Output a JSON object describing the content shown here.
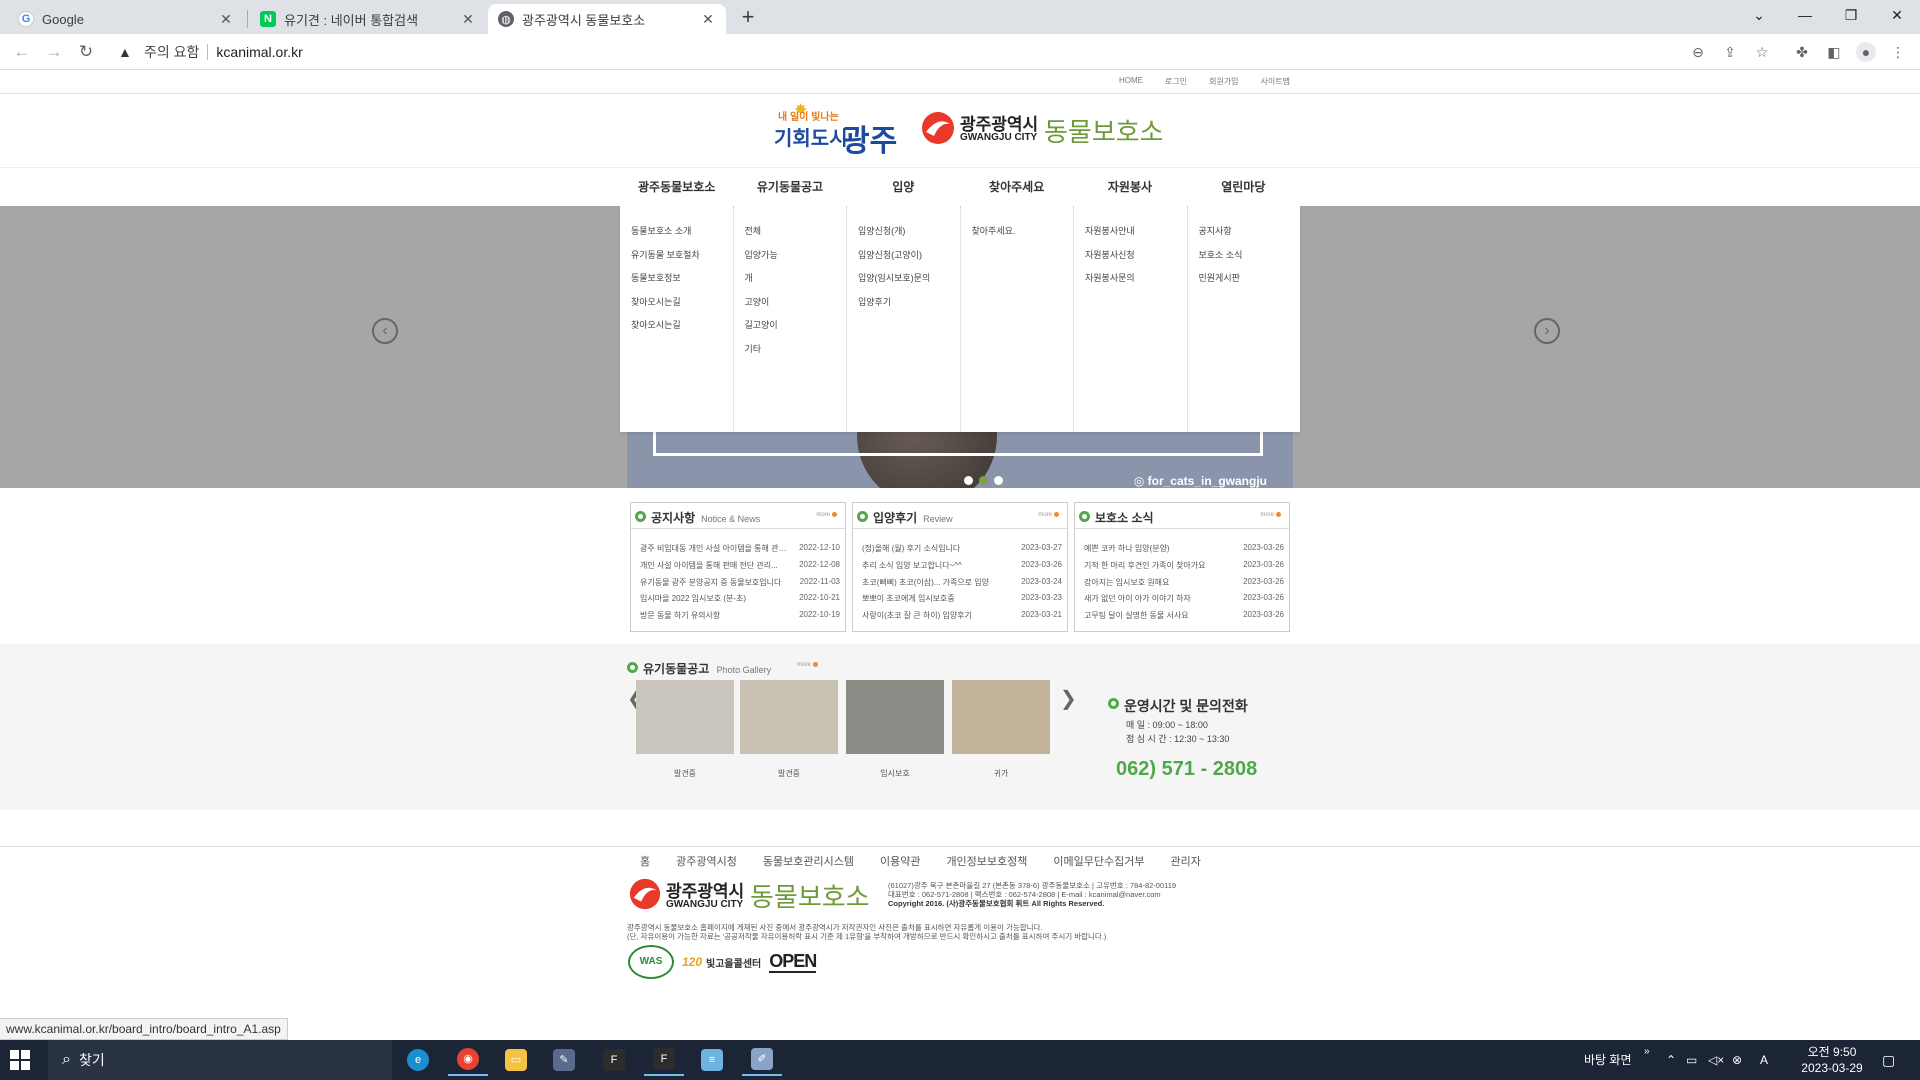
{
  "browser": {
    "tabs": [
      {
        "title": "Google",
        "favicon": "google-icon",
        "active": false
      },
      {
        "title": "유기견 : 네이버 통합검색",
        "favicon": "naver-icon",
        "active": false
      },
      {
        "title": "광주광역시 동물보호소",
        "favicon": "globe-icon",
        "active": true
      }
    ],
    "omnibox": {
      "security_label": "주의 요함",
      "url": "kcanimal.or.kr"
    },
    "status_url": "www.kcanimal.or.kr/board_intro/board_intro_A1.asp"
  },
  "site": {
    "utility_links": [
      "HOME",
      "로그인",
      "회원가입",
      "사이트맵"
    ],
    "logo_left": {
      "sub": "내 일이 빛나는",
      "main": "기회도시",
      "big": "광주"
    },
    "logo_center": {
      "korean": "광주광역시",
      "english": "GWANGJU CITY",
      "green": "동물보호소"
    },
    "gnb": [
      "광주동물보호소",
      "유기동물공고",
      "입양",
      "찾아주세요",
      "자원봉사",
      "열린마당"
    ],
    "mega_menu": [
      [
        "동물보호소 소개",
        "유기동물 보호절차",
        "동물보호정보",
        "찾아오시는길",
        "찾아오시는길"
      ],
      [
        "전체",
        "입양가능",
        "개",
        "고양이",
        "길고양이",
        "기타"
      ],
      [
        "입양신청(개)",
        "입양신청(고양이)",
        "입양(임시보호)문의",
        "입양후기"
      ],
      [
        "찾아주세요."
      ],
      [
        "자원봉사안내",
        "자원봉사신청",
        "자원봉사문의"
      ],
      [
        "공지사항",
        "보호소 소식",
        "민원게시판"
      ]
    ],
    "hero": {
      "instagram": "for_cats_in_gwangju",
      "active_dot": 1
    }
  },
  "boards": [
    {
      "title": "공지사항",
      "subtitle": "Notice & News",
      "more": "more",
      "rows": [
        {
          "title": "광주 비임대동 개인 사설 아이템을 통해 관리중...",
          "date": "2022-12-10"
        },
        {
          "title": "개인 사설 아이템을 통해 판매 전단 관리...",
          "date": "2022-12-08"
        },
        {
          "title": "유기동물 광주 분양공지 중 동물보호입니다",
          "date": "2022-11-03"
        },
        {
          "title": "입시마을 2022 임시보호 (분-초)",
          "date": "2022-10-21"
        },
        {
          "title": "방문 동물 하기 유의사항",
          "date": "2022-10-19"
        }
      ]
    },
    {
      "title": "입양후기",
      "subtitle": "Review",
      "more": "more",
      "rows": [
        {
          "title": "(정)올해 (월) 후기 소식입니다",
          "date": "2023-03-27"
        },
        {
          "title": "추리 소식 입양 보고합니다~^^",
          "date": "2023-03-26"
        },
        {
          "title": "초코(삐삐) 초코(이삼)... 가족으로 입양",
          "date": "2023-03-24"
        },
        {
          "title": "뽀뽀이 초코에게 임시보호중",
          "date": "2023-03-23"
        },
        {
          "title": "사랑이(초코 잘 큰 하이) 입양후기",
          "date": "2023-03-21"
        }
      ]
    },
    {
      "title": "보호소 소식",
      "subtitle": "",
      "more": "more",
      "rows": [
        {
          "title": "예쁜 코카 하나 입양(분양)",
          "date": "2023-03-26"
        },
        {
          "title": "기적 한 마리 후견인 가족이 찾아가요",
          "date": "2023-03-26"
        },
        {
          "title": "강아지는 임시보호 원해요",
          "date": "2023-03-26"
        },
        {
          "title": "새가 없던 아이 아가 이야기 하자",
          "date": "2023-03-26"
        },
        {
          "title": "고무팅 달이 실명한 동물 서사요",
          "date": "2023-03-26"
        }
      ]
    }
  ],
  "gallery": {
    "title": "유기동물공고",
    "subtitle": "Photo Gallery",
    "more": "more",
    "items": [
      {
        "caption": "발견중",
        "color": "#cbc6bd"
      },
      {
        "caption": "발견중",
        "color": "#c9c2b4"
      },
      {
        "caption": "임시보호",
        "color": "#8d8b85"
      },
      {
        "caption": "귀가",
        "color": "#c2b39b"
      }
    ]
  },
  "info": {
    "title": "운영시간 및 문의전화",
    "lines": [
      "매      일 : 09:00 ~ 18:00",
      "점 심 시 간 : 12:30 ~ 13:30"
    ],
    "phone": "062) 571 - 2808"
  },
  "footer": {
    "links": [
      "홈",
      "광주광역시청",
      "동물보호관리시스템",
      "이용약관",
      "개인정보보호정책",
      "이메일무단수집거부",
      "관리자"
    ],
    "address_lines": [
      "(61027)광주 북구 본촌마을길 27 (본촌동 378-6) 광주동물보호소  |  고유번호 : 784-82-00119",
      "대표번호 : 062-571-2808  |  팩스번호 : 062-574-2808  |  E-mail : kcanimal@naver.com",
      "Copyright 2016. (사)광주동물보호협회 휘트 All Rights Reserved."
    ],
    "copy_lines": [
      "광주광역시 동물보호소 홈페이지에 게재된 사진 중에서 광주광역시가 저작권자인 사진은 출처를 표시하면 자유롭게 이용이 가능합니다.",
      "(단, 자유이용이 가능한 자료는 '공공저작물 자유이용허락 표시 기준 제 1유형'을 부착하여 개방하므로 반드시 확인하시고 출처를 표시하여 주시기 바랍니다.)"
    ],
    "certs": {
      "was": "WAS",
      "bg_num": "120",
      "bg_text": "빛고을콜센터",
      "open": "OPEN"
    }
  },
  "taskbar": {
    "search_placeholder": "찾기",
    "desktop_label": "바탕 화면",
    "ime": "A",
    "time": "오전 9:50",
    "date": "2023-03-29"
  }
}
